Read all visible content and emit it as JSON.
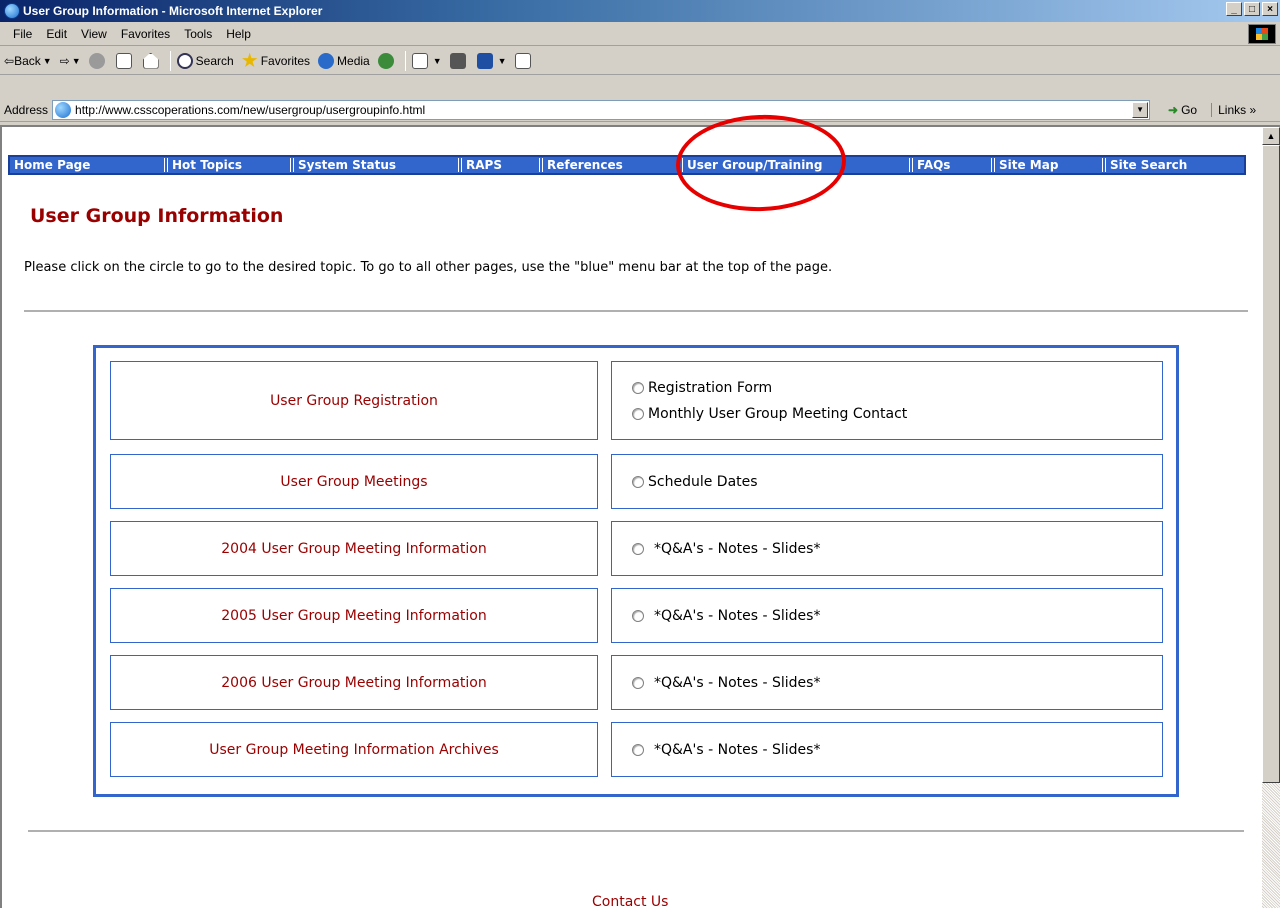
{
  "window": {
    "title": "User Group Information - Microsoft Internet Explorer",
    "controls": [
      "_",
      "□",
      "×"
    ]
  },
  "menu": [
    "File",
    "Edit",
    "View",
    "Favorites",
    "Tools",
    "Help"
  ],
  "toolbar": {
    "back": "Back",
    "search": "Search",
    "favorites": "Favorites",
    "media": "Media"
  },
  "address": {
    "label": "Address",
    "url": "http://www.csscoperations.com/new/usergroup/usergroupinfo.html",
    "go": "Go",
    "links": "Links »"
  },
  "nav": [
    "Home Page",
    "Hot Topics",
    "System Status",
    "RAPS",
    "References",
    "User Group/Training",
    "FAQs",
    "Site Map",
    "Site Search"
  ],
  "page": {
    "title": "User Group Information",
    "instructions": "Please click on the circle to go to the desired topic. To go to all other pages, use the \"blue\" menu bar at the top of the page.",
    "contact": "Contact Us"
  },
  "rows": [
    {
      "label": "User Group Registration",
      "options": [
        "Registration Form",
        "Monthly User Group Meeting Contact"
      ]
    },
    {
      "label": "User Group Meetings",
      "options": [
        "Schedule Dates"
      ]
    },
    {
      "label": "2004 User Group Meeting Information",
      "options": [
        "*Q&A's - Notes - Slides*"
      ]
    },
    {
      "label": "2005 User Group Meeting Information",
      "options": [
        "*Q&A's - Notes - Slides*"
      ]
    },
    {
      "label": "2006 User Group Meeting Information",
      "options": [
        "*Q&A's - Notes - Slides*"
      ]
    },
    {
      "label": "User Group Meeting Information Archives",
      "options": [
        "*Q&A's - Notes - Slides*"
      ]
    }
  ],
  "colors": {
    "nav_bg": "#3366cc",
    "title_red": "#990000",
    "annotation": "#e60000"
  }
}
